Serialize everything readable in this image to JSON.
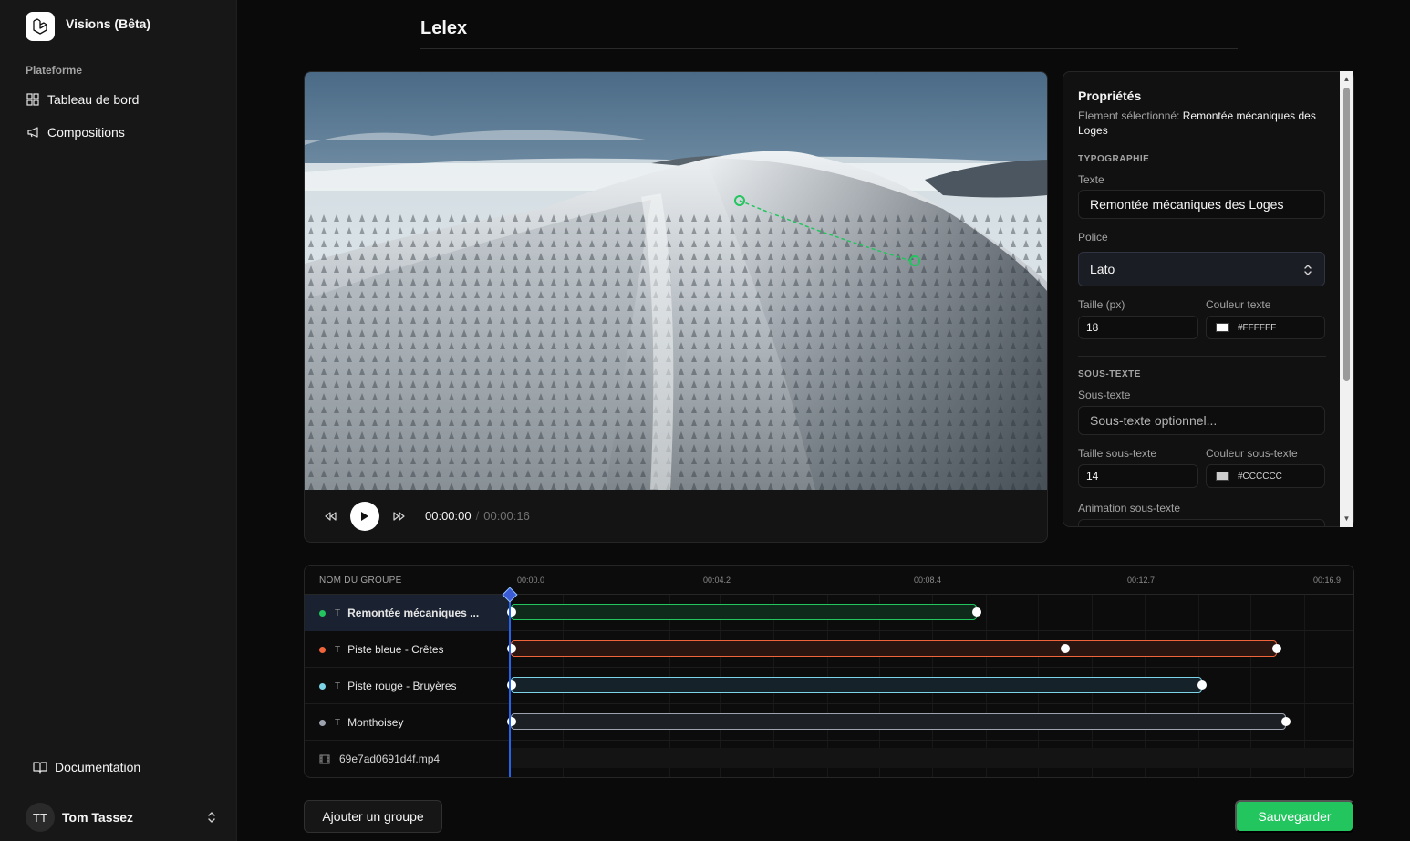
{
  "app": {
    "title": "Visions (Bêta)",
    "logo": "laravel-logo"
  },
  "sidebar": {
    "section_label": "Plateforme",
    "items": [
      {
        "label": "Tableau de bord",
        "icon": "grid-icon"
      },
      {
        "label": "Compositions",
        "icon": "megaphone-icon"
      }
    ],
    "doc_link": {
      "label": "Documentation",
      "icon": "book-icon"
    },
    "user": {
      "initials": "TT",
      "name": "Tom Tassez"
    }
  },
  "page": {
    "title": "Lelex"
  },
  "player": {
    "time_current": "00:00:00",
    "time_separator": "/",
    "time_total": "00:00:16"
  },
  "properties": {
    "title": "Propriétés",
    "selected_prefix": "Element sélectionné:",
    "selected_name": "Remontée mécaniques des Loges",
    "typography_heading": "TYPOGRAPHIE",
    "text_label": "Texte",
    "text_value": "Remontée mécaniques des Loges",
    "font_label": "Police",
    "font_value": "Lato",
    "size_label": "Taille (px)",
    "size_value": "18",
    "color_label": "Couleur texte",
    "color_value": "#FFFFFF",
    "subtext_heading": "SOUS-TEXTE",
    "subtext_label": "Sous-texte",
    "subtext_placeholder": "Sous-texte optionnel...",
    "subtext_size_label": "Taille sous-texte",
    "subtext_size_value": "14",
    "subtext_color_label": "Couleur sous-texte",
    "subtext_color_value": "#CCCCCC",
    "subtext_animation_label": "Animation sous-texte"
  },
  "timeline": {
    "header_label": "NOM DU GROUPE",
    "ticks": [
      "00:00.0",
      "00:04.2",
      "00:08.4",
      "00:12.7",
      "00:16.9"
    ],
    "groups": [
      {
        "name": "Remontée mécaniques ...",
        "color": "#22c55e",
        "type_icon": "T"
      },
      {
        "name": "Piste bleue - Crêtes",
        "color": "#f0643c",
        "type_icon": "T"
      },
      {
        "name": "Piste rouge - Bruyères",
        "color": "#7dd3e8",
        "type_icon": "T"
      },
      {
        "name": "Monthoisey",
        "color": "#9ca3af",
        "type_icon": "T"
      }
    ],
    "media_file": "69e7ad0691d4f.mp4"
  },
  "actions": {
    "add_group": "Ajouter un groupe",
    "save": "Sauvegarder"
  }
}
